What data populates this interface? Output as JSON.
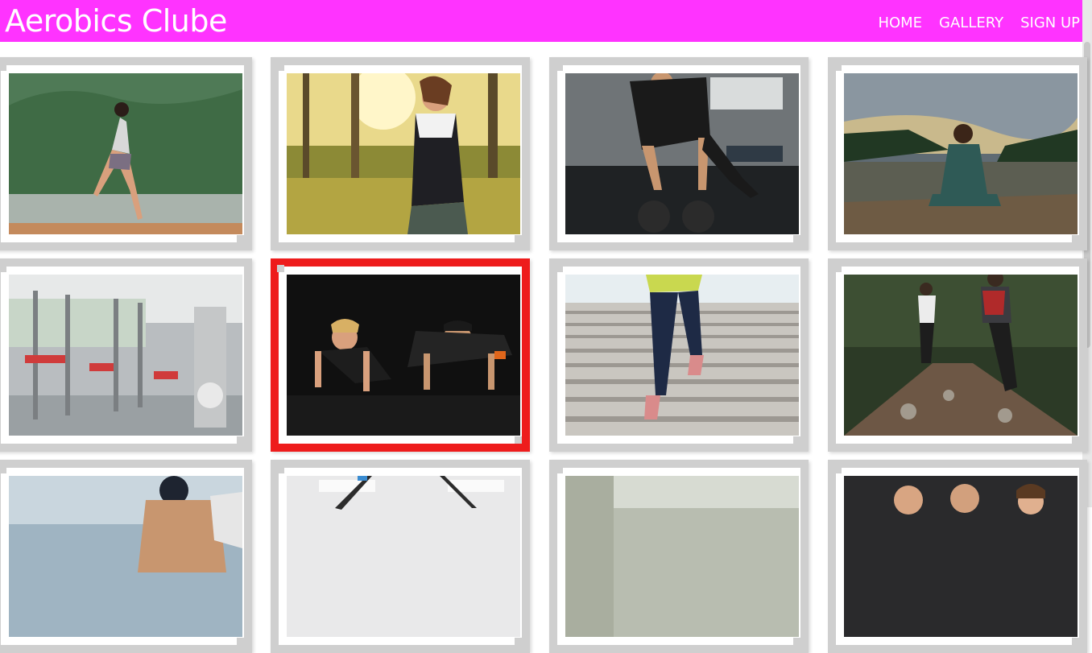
{
  "header": {
    "brand": "Aerobics Clube",
    "background": "#ff33ff",
    "nav": [
      {
        "label": "HOME"
      },
      {
        "label": "GALLERY"
      },
      {
        "label": "SIGN UP"
      }
    ]
  },
  "gallery": {
    "frame_color": "#cfcfcf",
    "selected_frame_color": "#ee1c1c",
    "selected_index": 5,
    "items": [
      {
        "name": "woman-running-lakeside-photo"
      },
      {
        "name": "woman-jogging-forest-photo"
      },
      {
        "name": "man-kettlebell-pushup-photo"
      },
      {
        "name": "woman-meditating-dock-photo"
      },
      {
        "name": "gym-equipment-room-photo"
      },
      {
        "name": "couple-pushups-photo"
      },
      {
        "name": "runner-climbing-stairs-photo"
      },
      {
        "name": "trail-runners-forest-photo"
      },
      {
        "name": "man-boxing-photo"
      },
      {
        "name": "suspension-straps-gym-photo"
      },
      {
        "name": "gym-interior-photo"
      },
      {
        "name": "team-portrait-photo"
      }
    ]
  }
}
